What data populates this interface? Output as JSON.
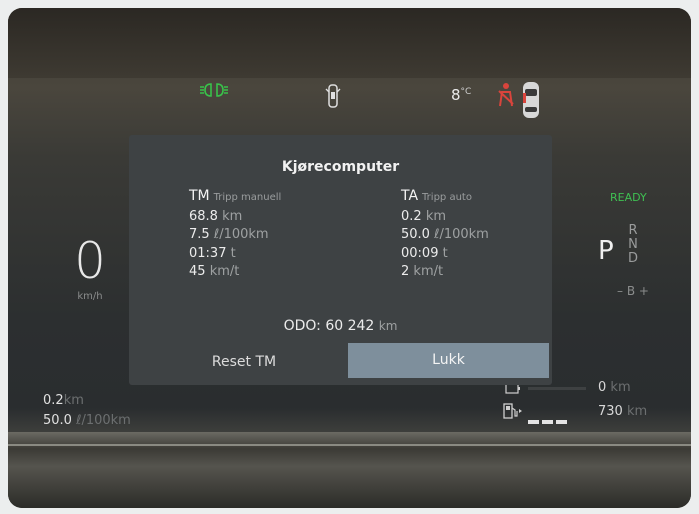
{
  "indicators": {
    "outside_temp": "8",
    "temp_unit": "°C",
    "icons": [
      "headlight-icon",
      "door-open-icon",
      "seatbelt-warning-icon",
      "car-top-icon"
    ],
    "colors": {
      "headlight": "#39c24a",
      "seatbelt": "#d9443c"
    }
  },
  "speedometer": {
    "value": "0",
    "unit": "km/h"
  },
  "left_trip": {
    "distance_value": "0.2",
    "distance_unit": "km",
    "consumption_value": "50.0",
    "consumption_unit": "ℓ/100km"
  },
  "drive": {
    "status": "READY",
    "gear_selected": "P",
    "gear_r": "R",
    "gear_n": "N",
    "gear_d": "D",
    "gear_mode": "– B +"
  },
  "range": {
    "battery_value": "0",
    "battery_unit": "km",
    "fuel_value": "730",
    "fuel_unit": "km"
  },
  "trip_computer": {
    "title": "Kjørecomputer",
    "manual": {
      "code": "TM",
      "label": "Tripp manuell",
      "distance": "68.8",
      "distance_unit": "km",
      "consumption": "7.5",
      "consumption_unit": "ℓ/100km",
      "time": "01:37",
      "time_unit": "t",
      "avg_speed": "45",
      "speed_unit": "km/t"
    },
    "auto": {
      "code": "TA",
      "label": "Tripp auto",
      "distance": "0.2",
      "distance_unit": "km",
      "consumption": "50.0",
      "consumption_unit": "ℓ/100km",
      "time": "00:09",
      "time_unit": "t",
      "avg_speed": "2",
      "speed_unit": "km/t"
    },
    "odo_label": "ODO:",
    "odo_value": "60 242",
    "odo_unit": "km",
    "reset_button": "Reset TM",
    "close_button": "Lukk"
  }
}
